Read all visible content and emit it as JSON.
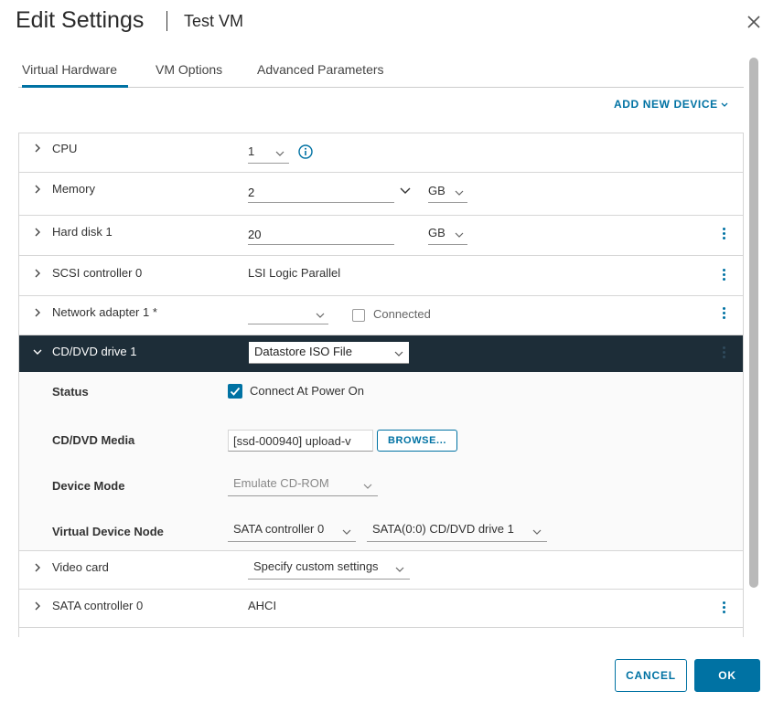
{
  "dialog": {
    "title": "Edit Settings",
    "vm_name": "Test VM"
  },
  "tabs": [
    {
      "label": "Virtual Hardware",
      "active": true
    },
    {
      "label": "VM Options",
      "active": false
    },
    {
      "label": "Advanced Parameters",
      "active": false
    }
  ],
  "add_new_device": "ADD NEW DEVICE",
  "hardware": {
    "cpu": {
      "label": "CPU",
      "value": "1"
    },
    "memory": {
      "label": "Memory",
      "value": "2",
      "unit": "GB"
    },
    "hard_disk": {
      "label": "Hard disk 1",
      "value": "20",
      "unit": "GB"
    },
    "scsi": {
      "label": "SCSI controller 0",
      "value": "LSI Logic Parallel"
    },
    "network": {
      "label": "Network adapter 1 *",
      "value": "",
      "connected_label": "Connected"
    },
    "cdrom": {
      "label": "CD/DVD drive 1",
      "value": "Datastore ISO File",
      "status_label": "Status",
      "connect_label": "Connect At Power On",
      "media_label": "CD/DVD Media",
      "media_value": "[ssd-000940] upload-v",
      "browse_label": "BROWSE...",
      "device_mode_label": "Device Mode",
      "device_mode_value": "Emulate CD-ROM",
      "vdn_label": "Virtual Device Node",
      "vdn_controller": "SATA controller 0",
      "vdn_node": "SATA(0:0) CD/DVD drive 1"
    },
    "video": {
      "label": "Video card",
      "value": "Specify custom settings"
    },
    "sata": {
      "label": "SATA controller 0",
      "value": "AHCI"
    }
  },
  "footer": {
    "cancel": "CANCEL",
    "ok": "OK"
  },
  "colors": {
    "accent": "#0072a3",
    "dark_row": "#1d2d38"
  }
}
